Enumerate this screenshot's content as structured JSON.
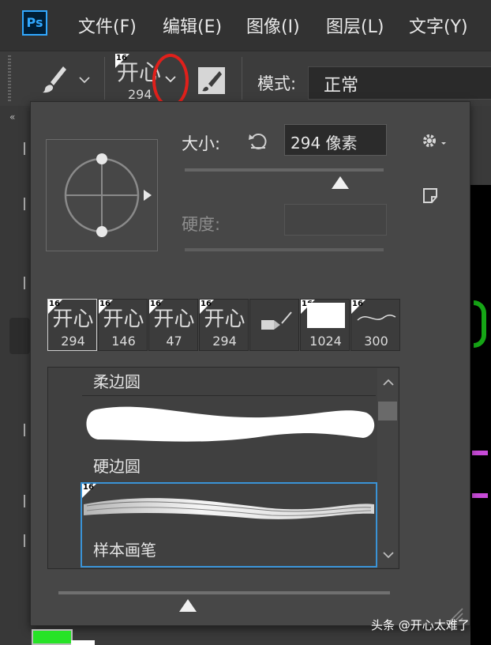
{
  "menubar": {
    "logo": "Ps",
    "items": [
      "文件(F)",
      "编辑(E)",
      "图像(I)",
      "图层(L)",
      "文字(Y)"
    ]
  },
  "options": {
    "brush_glyph": "开心",
    "brush_size": "294",
    "brush_corner": "16",
    "mode_label": "模式:",
    "mode_value": "正常"
  },
  "popup": {
    "size_label": "大小:",
    "size_value": "294 像素",
    "size_slider_fraction": 0.78,
    "hardness_label": "硬度:",
    "hardness_value": "",
    "presets": [
      {
        "corner": "16",
        "glyph": "开心",
        "num": "294",
        "selected": true
      },
      {
        "corner": "16",
        "glyph": "开心",
        "num": "146",
        "selected": false
      },
      {
        "corner": "16",
        "glyph": "开心",
        "num": "47",
        "selected": false
      },
      {
        "corner": "16",
        "glyph": "开心",
        "num": "294",
        "selected": false
      },
      {
        "corner": "",
        "glyph": "",
        "num": "",
        "selected": false,
        "icon": "pencil-icon"
      },
      {
        "corner": "16",
        "glyph": "",
        "num": "1024",
        "selected": false,
        "icon": "sample-thumbnail"
      },
      {
        "corner": "16",
        "glyph": "",
        "num": "300",
        "selected": false,
        "icon": "stroke-icon"
      }
    ],
    "list": {
      "items": [
        {
          "label": "柔边圆"
        },
        {
          "label": "硬边圆"
        },
        {
          "label": "样本画笔",
          "corner": "16"
        }
      ]
    },
    "bottom_slider_fraction": 0.39
  },
  "watermark": "头条 @开心太难了",
  "colors": {
    "highlight_circle": "#e0201b",
    "selection_border": "#3a93d6",
    "foreground_swatch": "#27e327"
  }
}
